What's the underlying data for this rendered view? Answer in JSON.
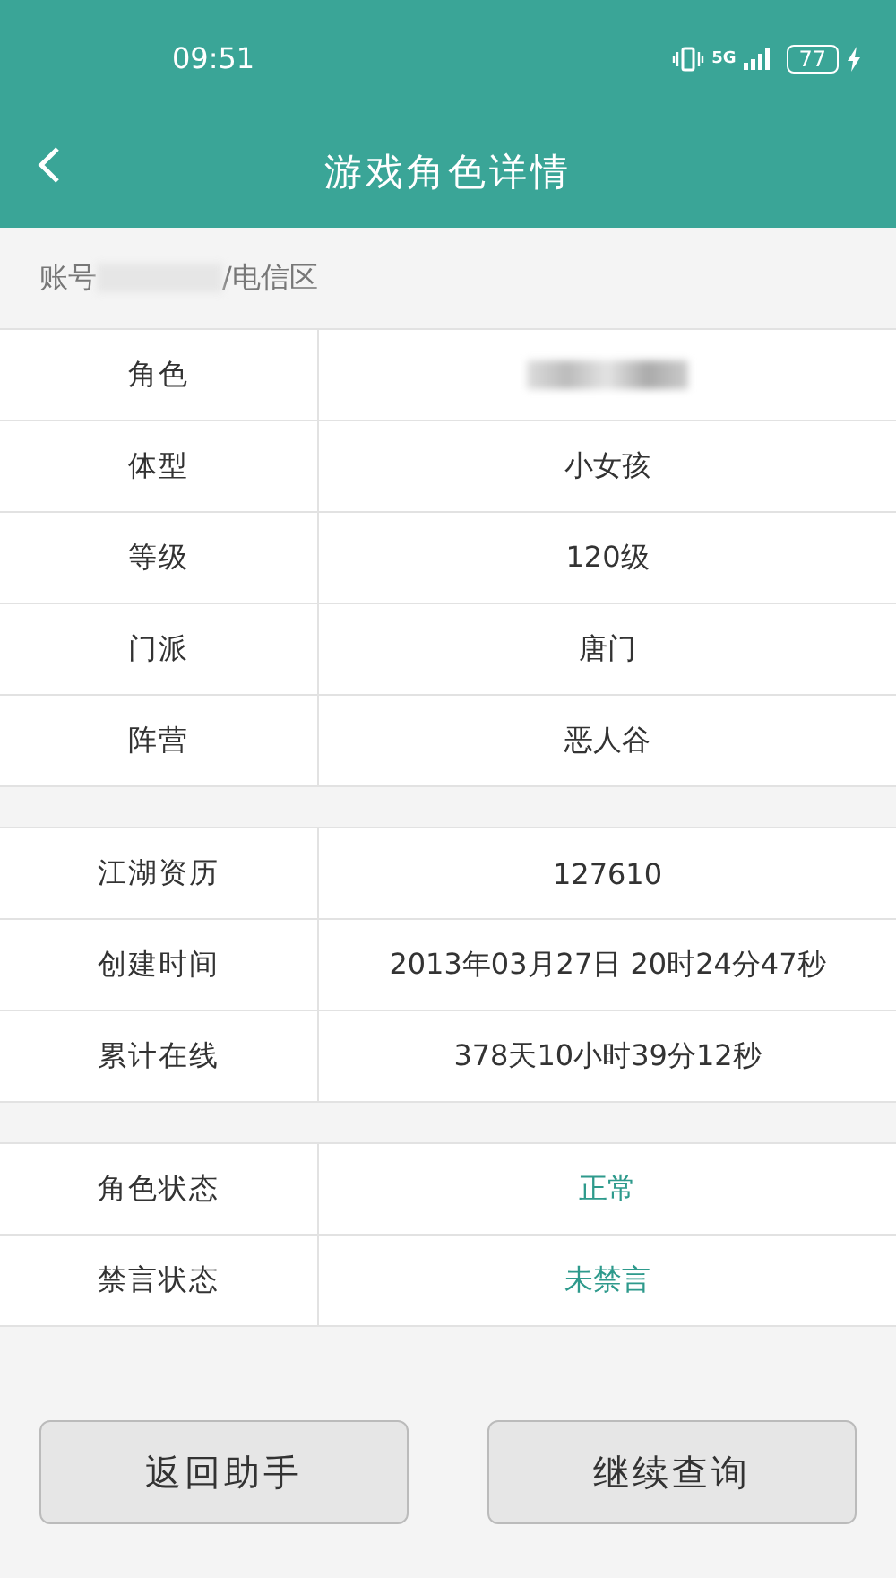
{
  "status_bar": {
    "time": "09:51",
    "network": "5G",
    "battery": "77"
  },
  "header": {
    "title": "游戏角色详情"
  },
  "account": {
    "prefix": "账号",
    "suffix": "/电信区"
  },
  "groups": [
    {
      "rows": [
        {
          "label": "角色",
          "kind": "blurred"
        },
        {
          "label": "体型",
          "kind": "plain",
          "value": "小女孩"
        },
        {
          "label": "等级",
          "kind": "plain",
          "value": "120级"
        },
        {
          "label": "门派",
          "kind": "plain",
          "value": "唐门"
        },
        {
          "label": "阵营",
          "kind": "plain",
          "value": "恶人谷"
        }
      ]
    },
    {
      "rows": [
        {
          "label": "江湖资历",
          "kind": "plain",
          "value": "127610"
        },
        {
          "label": "创建时间",
          "kind": "plain",
          "value": "2013年03月27日  20时24分47秒"
        },
        {
          "label": "累计在线",
          "kind": "plain",
          "value": "378天10小时39分12秒"
        }
      ]
    },
    {
      "rows": [
        {
          "label": "角色状态",
          "kind": "status",
          "value": "正常"
        },
        {
          "label": "禁言状态",
          "kind": "status",
          "value": "未禁言"
        }
      ]
    }
  ],
  "buttons": [
    "返回助手",
    "继续查询"
  ]
}
